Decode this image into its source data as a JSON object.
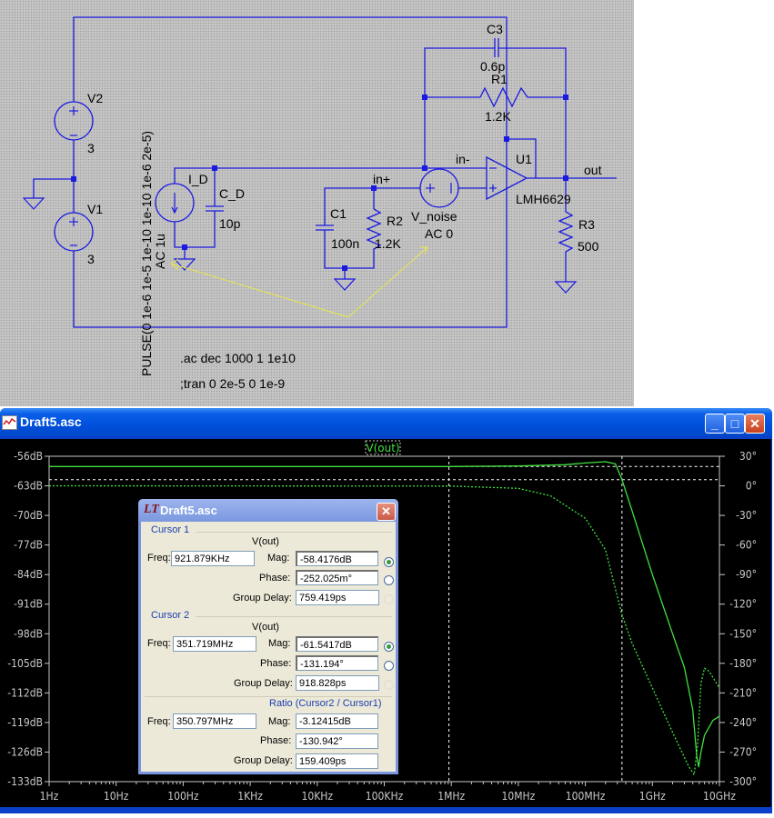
{
  "schematic": {
    "v2": "V2",
    "v2_value": "3",
    "v1": "V1",
    "v1_value": "3",
    "pulse": "PULSE(0 1e-6 1e-5 1e-10 1e-10 1e-6 2e-5)",
    "i_d_ac": "AC 1u",
    "i_d": "I_D",
    "c_d": "C_D",
    "c_d_value": "10p",
    "c1": "C1",
    "c1_value": "100n",
    "r2": "R2",
    "r2_value": "1.2K",
    "v_noise": "V_noise",
    "v_noise_value": "AC 0",
    "c3": "C3",
    "c3_value": "0.6p",
    "r1": "R1",
    "r1_value": "1.2K",
    "u1": "U1",
    "u1_model": "LMH6629",
    "r3": "R3",
    "r3_value": "500",
    "net_in_minus": "in-",
    "net_in_plus": "in+",
    "net_out": "out",
    "directive_ac": ".ac dec 1000 1 1e10",
    "directive_tran": ";tran 0 2e-5 0 1e-9",
    "colors": {
      "wire": "#1a1ae0",
      "background": "#c3c3c3",
      "annotation_arrow": "#e8e84a"
    }
  },
  "waveform_window": {
    "title": "Draft5.asc",
    "icon": "waveform-icon",
    "buttons": {
      "minimize": "_",
      "maximize": "□",
      "close": "✕"
    }
  },
  "chart_data": {
    "type": "line",
    "trace_label": "V(out)",
    "xscale": "log",
    "xlim": [
      1,
      10000000000
    ],
    "ylim": [
      -133,
      -56
    ],
    "y2lim": [
      -300,
      30
    ],
    "x_tick_labels": [
      "1Hz",
      "10Hz",
      "100Hz",
      "1KHz",
      "10KHz",
      "100KHz",
      "1MHz",
      "10MHz",
      "100MHz",
      "1GHz",
      "10GHz"
    ],
    "y_tick_labels": [
      "-56dB",
      "-63dB",
      "-70dB",
      "-77dB",
      "-84dB",
      "-91dB",
      "-98dB",
      "-105dB",
      "-112dB",
      "-119dB",
      "-126dB",
      "-133dB"
    ],
    "y2_tick_labels": [
      "30°",
      "0°",
      "-30°",
      "-60°",
      "-90°",
      "-120°",
      "-150°",
      "-180°",
      "-210°",
      "-240°",
      "-270°",
      "-300°"
    ],
    "grid": false,
    "colors": {
      "trace": "#40e040",
      "background": "#000000",
      "axis": "#c8c8c8",
      "cursor": "#ffffff"
    },
    "series": [
      {
        "name": "V(out)",
        "quantity": "magnitude",
        "unit": "dB",
        "style": "solid",
        "x": [
          1,
          1000000,
          10000000,
          50000000,
          100000000,
          200000000,
          280000000,
          351719000,
          500000000,
          1000000000,
          2000000000,
          3000000000,
          4000000000,
          4600000000,
          4900000000,
          5300000000,
          6000000000,
          8000000000,
          10000000000
        ],
        "y": [
          -58.42,
          -58.42,
          -58.3,
          -58.0,
          -57.6,
          -57.3,
          -57.8,
          -61.54,
          -69,
          -84,
          -98,
          -106,
          -116,
          -127,
          -129.5,
          -126,
          -122,
          -118.5,
          -117.5
        ]
      },
      {
        "name": "V(out)",
        "quantity": "phase",
        "unit": "deg",
        "style": "dashed",
        "x": [
          1,
          1000000,
          10000000,
          30000000,
          100000000,
          200000000,
          351719000,
          500000000,
          1000000000,
          2000000000,
          3500000000,
          4200000000,
          4700000000,
          5300000000,
          6000000000,
          7000000000,
          10000000000
        ],
        "y": [
          0,
          -0.25,
          -2.5,
          -10,
          -33,
          -65,
          -131,
          -160,
          -205,
          -250,
          -285,
          -293,
          -265,
          -200,
          -185,
          -188,
          -205
        ]
      }
    ],
    "cursors": [
      {
        "name": "Cursor 1",
        "freq_hz": 921879,
        "mag_db": -58.4176
      },
      {
        "name": "Cursor 2",
        "freq_hz": 351719000,
        "mag_db": -61.5417
      }
    ]
  },
  "cursor_dialog": {
    "title": "Draft5.asc",
    "close": "✕",
    "cursor1": {
      "header": "Cursor 1",
      "trace": "V(out)",
      "freq_label": "Freq:",
      "freq": "921.879KHz",
      "mag_label": "Mag:",
      "mag": "-58.4176dB",
      "phase_label": "Phase:",
      "phase": "-252.025m°",
      "gd_label": "Group Delay:",
      "gd": "759.419ps"
    },
    "cursor2": {
      "header": "Cursor 2",
      "trace": "V(out)",
      "freq_label": "Freq:",
      "freq": "351.719MHz",
      "mag_label": "Mag:",
      "mag": "-61.5417dB",
      "phase_label": "Phase:",
      "phase": "-131.194°",
      "gd_label": "Group Delay:",
      "gd": "918.828ps"
    },
    "ratio": {
      "header": "Ratio (Cursor2 / Cursor1)",
      "freq_label": "Freq:",
      "freq": "350.797MHz",
      "mag_label": "Mag:",
      "mag": "-3.12415dB",
      "phase_label": "Phase:",
      "phase": "-130.942°",
      "gd_label": "Group Delay:",
      "gd": "159.409ps"
    }
  }
}
